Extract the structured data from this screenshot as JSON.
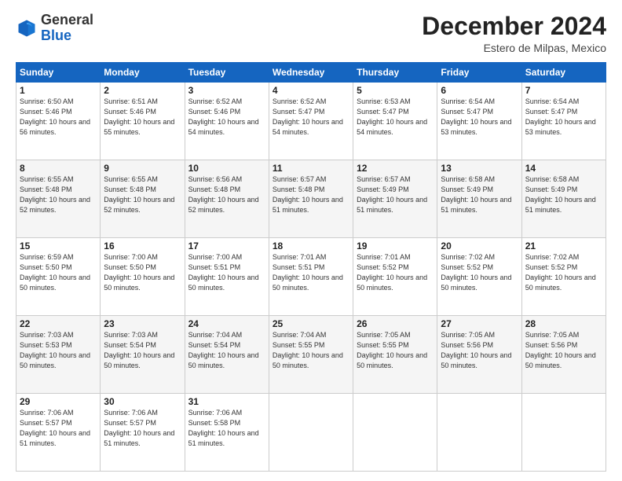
{
  "logo": {
    "general": "General",
    "blue": "Blue"
  },
  "header": {
    "title": "December 2024",
    "subtitle": "Estero de Milpas, Mexico"
  },
  "weekdays": [
    "Sunday",
    "Monday",
    "Tuesday",
    "Wednesday",
    "Thursday",
    "Friday",
    "Saturday"
  ],
  "weeks": [
    [
      {
        "day": "1",
        "sunrise": "6:50 AM",
        "sunset": "5:46 PM",
        "daylight": "10 hours and 56 minutes."
      },
      {
        "day": "2",
        "sunrise": "6:51 AM",
        "sunset": "5:46 PM",
        "daylight": "10 hours and 55 minutes."
      },
      {
        "day": "3",
        "sunrise": "6:52 AM",
        "sunset": "5:46 PM",
        "daylight": "10 hours and 54 minutes."
      },
      {
        "day": "4",
        "sunrise": "6:52 AM",
        "sunset": "5:47 PM",
        "daylight": "10 hours and 54 minutes."
      },
      {
        "day": "5",
        "sunrise": "6:53 AM",
        "sunset": "5:47 PM",
        "daylight": "10 hours and 54 minutes."
      },
      {
        "day": "6",
        "sunrise": "6:54 AM",
        "sunset": "5:47 PM",
        "daylight": "10 hours and 53 minutes."
      },
      {
        "day": "7",
        "sunrise": "6:54 AM",
        "sunset": "5:47 PM",
        "daylight": "10 hours and 53 minutes."
      }
    ],
    [
      {
        "day": "8",
        "sunrise": "6:55 AM",
        "sunset": "5:48 PM",
        "daylight": "10 hours and 52 minutes."
      },
      {
        "day": "9",
        "sunrise": "6:55 AM",
        "sunset": "5:48 PM",
        "daylight": "10 hours and 52 minutes."
      },
      {
        "day": "10",
        "sunrise": "6:56 AM",
        "sunset": "5:48 PM",
        "daylight": "10 hours and 52 minutes."
      },
      {
        "day": "11",
        "sunrise": "6:57 AM",
        "sunset": "5:48 PM",
        "daylight": "10 hours and 51 minutes."
      },
      {
        "day": "12",
        "sunrise": "6:57 AM",
        "sunset": "5:49 PM",
        "daylight": "10 hours and 51 minutes."
      },
      {
        "day": "13",
        "sunrise": "6:58 AM",
        "sunset": "5:49 PM",
        "daylight": "10 hours and 51 minutes."
      },
      {
        "day": "14",
        "sunrise": "6:58 AM",
        "sunset": "5:49 PM",
        "daylight": "10 hours and 51 minutes."
      }
    ],
    [
      {
        "day": "15",
        "sunrise": "6:59 AM",
        "sunset": "5:50 PM",
        "daylight": "10 hours and 50 minutes."
      },
      {
        "day": "16",
        "sunrise": "7:00 AM",
        "sunset": "5:50 PM",
        "daylight": "10 hours and 50 minutes."
      },
      {
        "day": "17",
        "sunrise": "7:00 AM",
        "sunset": "5:51 PM",
        "daylight": "10 hours and 50 minutes."
      },
      {
        "day": "18",
        "sunrise": "7:01 AM",
        "sunset": "5:51 PM",
        "daylight": "10 hours and 50 minutes."
      },
      {
        "day": "19",
        "sunrise": "7:01 AM",
        "sunset": "5:52 PM",
        "daylight": "10 hours and 50 minutes."
      },
      {
        "day": "20",
        "sunrise": "7:02 AM",
        "sunset": "5:52 PM",
        "daylight": "10 hours and 50 minutes."
      },
      {
        "day": "21",
        "sunrise": "7:02 AM",
        "sunset": "5:52 PM",
        "daylight": "10 hours and 50 minutes."
      }
    ],
    [
      {
        "day": "22",
        "sunrise": "7:03 AM",
        "sunset": "5:53 PM",
        "daylight": "10 hours and 50 minutes."
      },
      {
        "day": "23",
        "sunrise": "7:03 AM",
        "sunset": "5:54 PM",
        "daylight": "10 hours and 50 minutes."
      },
      {
        "day": "24",
        "sunrise": "7:04 AM",
        "sunset": "5:54 PM",
        "daylight": "10 hours and 50 minutes."
      },
      {
        "day": "25",
        "sunrise": "7:04 AM",
        "sunset": "5:55 PM",
        "daylight": "10 hours and 50 minutes."
      },
      {
        "day": "26",
        "sunrise": "7:05 AM",
        "sunset": "5:55 PM",
        "daylight": "10 hours and 50 minutes."
      },
      {
        "day": "27",
        "sunrise": "7:05 AM",
        "sunset": "5:56 PM",
        "daylight": "10 hours and 50 minutes."
      },
      {
        "day": "28",
        "sunrise": "7:05 AM",
        "sunset": "5:56 PM",
        "daylight": "10 hours and 50 minutes."
      }
    ],
    [
      {
        "day": "29",
        "sunrise": "7:06 AM",
        "sunset": "5:57 PM",
        "daylight": "10 hours and 51 minutes."
      },
      {
        "day": "30",
        "sunrise": "7:06 AM",
        "sunset": "5:57 PM",
        "daylight": "10 hours and 51 minutes."
      },
      {
        "day": "31",
        "sunrise": "7:06 AM",
        "sunset": "5:58 PM",
        "daylight": "10 hours and 51 minutes."
      },
      null,
      null,
      null,
      null
    ]
  ]
}
